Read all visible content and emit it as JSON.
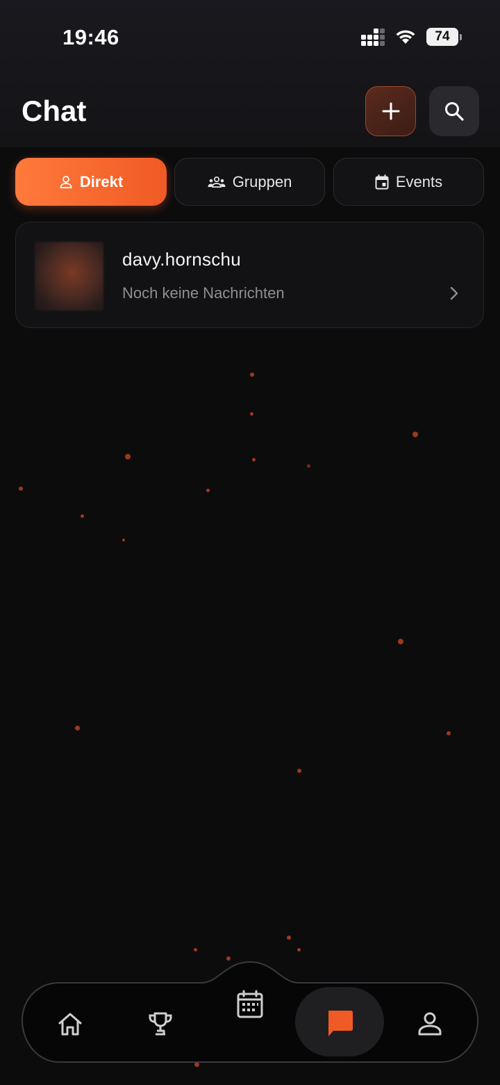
{
  "status_bar": {
    "time": "19:46",
    "battery": "74",
    "icons": [
      "cellular-signal-icon",
      "wifi-icon",
      "battery-icon"
    ]
  },
  "header": {
    "title": "Chat",
    "add_icon": "plus-icon",
    "search_icon": "search-icon"
  },
  "tabs": [
    {
      "label": "Direkt",
      "icon": "person-icon",
      "active": true
    },
    {
      "label": "Gruppen",
      "icon": "group-icon",
      "active": false
    },
    {
      "label": "Events",
      "icon": "calendar-event-icon",
      "active": false
    }
  ],
  "chats": [
    {
      "name": "davy.hornschu",
      "preview": "Noch keine Nachrichten",
      "icon": "chevron-right-icon"
    }
  ],
  "bottom_nav": {
    "items": [
      {
        "name": "home",
        "icon": "home-icon",
        "active": false
      },
      {
        "name": "trophy",
        "icon": "trophy-icon",
        "active": false
      },
      {
        "name": "calendar",
        "icon": "calendar-icon",
        "active": false
      },
      {
        "name": "chat",
        "icon": "chat-bubble-icon",
        "active": true
      },
      {
        "name": "profile",
        "icon": "person-icon",
        "active": false
      }
    ]
  },
  "colors": {
    "accent": "#f05a24",
    "accent_light": "#ff7a3c",
    "background": "#0c0c0d",
    "card": "#121214",
    "muted_text": "#8e8e93"
  }
}
